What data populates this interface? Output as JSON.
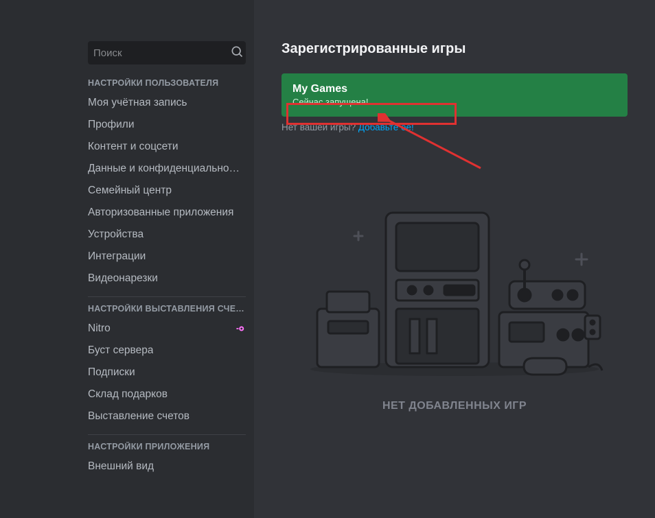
{
  "search": {
    "placeholder": "Поиск"
  },
  "sidebar": {
    "categories": [
      {
        "header": "НАСТРОЙКИ ПОЛЬЗОВАТЕЛЯ",
        "items": [
          {
            "label": "Моя учётная запись"
          },
          {
            "label": "Профили"
          },
          {
            "label": "Контент и соцсети"
          },
          {
            "label": "Данные и конфиденциально…"
          },
          {
            "label": "Семейный центр"
          },
          {
            "label": "Авторизованные приложения"
          },
          {
            "label": "Устройства"
          },
          {
            "label": "Интеграции"
          },
          {
            "label": "Видеонарезки"
          }
        ]
      },
      {
        "header": "НАСТРОЙКИ ВЫСТАВЛЕНИЯ СЧЕТ…",
        "items": [
          {
            "label": "Nitro",
            "badge": "nitro"
          },
          {
            "label": "Буст сервера"
          },
          {
            "label": "Подписки"
          },
          {
            "label": "Склад подарков"
          },
          {
            "label": "Выставление счетов"
          }
        ]
      },
      {
        "header": "НАСТРОЙКИ ПРИЛОЖЕНИЯ",
        "items": [
          {
            "label": "Внешний вид"
          }
        ]
      }
    ]
  },
  "main": {
    "title": "Зарегистрированные игры",
    "game_banner": {
      "name_value": "My Games",
      "status": "Сейчас запущена!"
    },
    "missing_text": "Нет вашей игры? ",
    "add_link": "Добавьте её!",
    "empty_caption": "НЕТ ДОБАВЛЕННЫХ ИГР"
  },
  "colors": {
    "accent_green": "#248045",
    "link_blue": "#00a8fc",
    "annotation_red": "#e03131",
    "nitro_pink": "#ff73fa"
  }
}
